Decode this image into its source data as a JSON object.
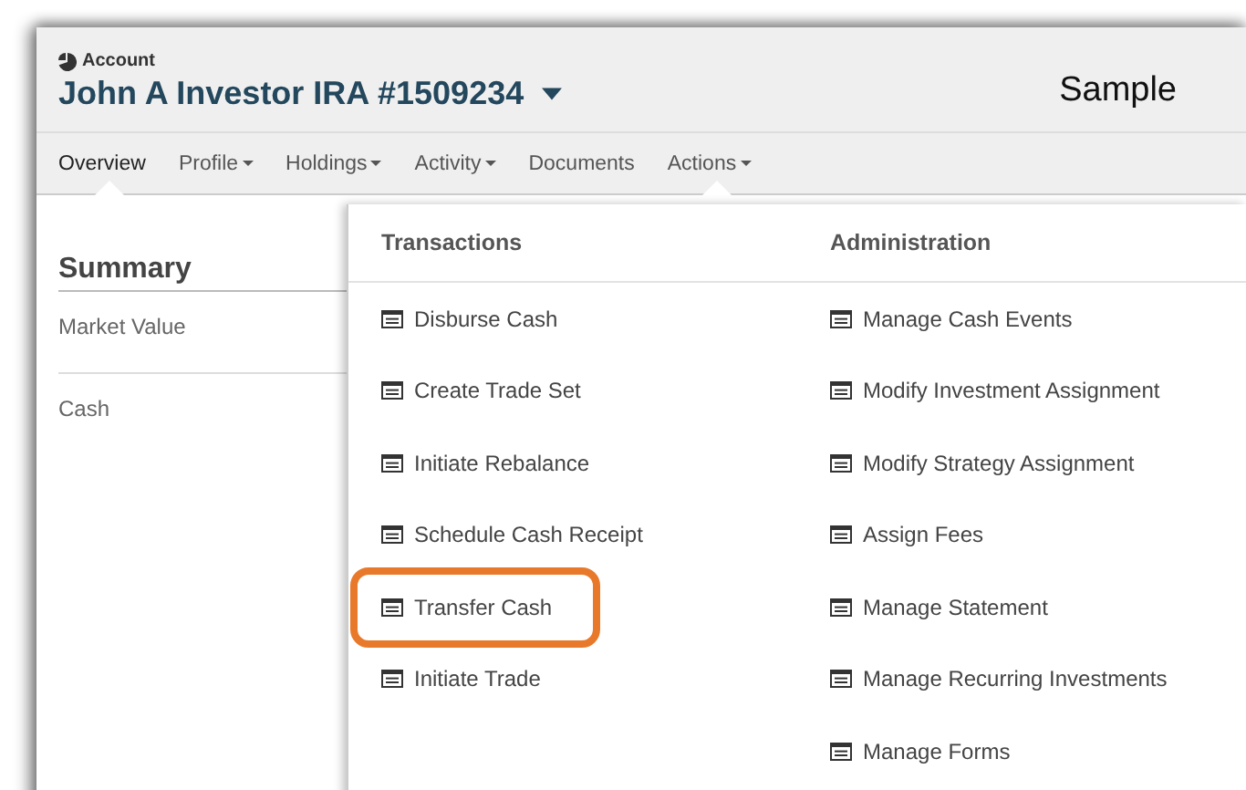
{
  "header": {
    "label": "Account",
    "title": "John A Investor IRA #1509234",
    "sample_label": "Sample"
  },
  "nav": [
    {
      "label": "Overview",
      "selected": true,
      "menu": false,
      "open": false
    },
    {
      "label": "Profile",
      "selected": false,
      "menu": true,
      "open": false
    },
    {
      "label": "Holdings",
      "selected": false,
      "menu": true,
      "open": false
    },
    {
      "label": "Activity",
      "selected": false,
      "menu": true,
      "open": false
    },
    {
      "label": "Documents",
      "selected": false,
      "menu": false,
      "open": false
    },
    {
      "label": "Actions",
      "selected": false,
      "menu": true,
      "open": true
    }
  ],
  "summary": {
    "title": "Summary",
    "rows": [
      "Market Value",
      "Cash"
    ]
  },
  "actions_menu": [
    {
      "heading": "Transactions",
      "items": [
        {
          "label": "Disburse Cash",
          "highlighted": false
        },
        {
          "label": "Create Trade Set",
          "highlighted": false
        },
        {
          "label": "Initiate Rebalance",
          "highlighted": false
        },
        {
          "label": "Schedule Cash Receipt",
          "highlighted": false
        },
        {
          "label": "Transfer Cash",
          "highlighted": true
        },
        {
          "label": "Initiate Trade",
          "highlighted": false
        }
      ]
    },
    {
      "heading": "Administration",
      "items": [
        {
          "label": "Manage Cash Events",
          "highlighted": false
        },
        {
          "label": "Modify Investment Assignment",
          "highlighted": false
        },
        {
          "label": "Modify Strategy Assignment",
          "highlighted": false
        },
        {
          "label": "Assign Fees",
          "highlighted": false
        },
        {
          "label": "Manage Statement",
          "highlighted": false
        },
        {
          "label": "Manage Recurring Investments",
          "highlighted": false
        },
        {
          "label": "Manage Forms",
          "highlighted": false
        }
      ]
    }
  ]
}
